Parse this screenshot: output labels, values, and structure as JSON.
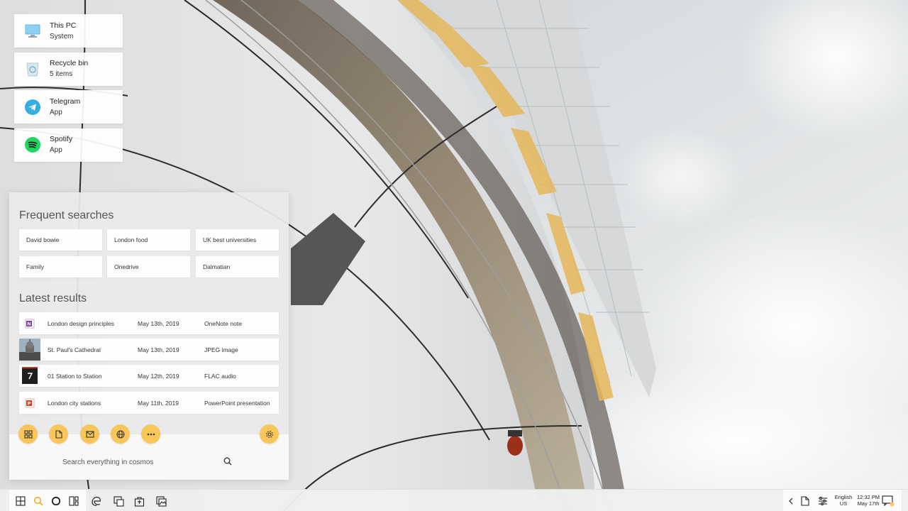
{
  "desktop": {
    "tiles": [
      {
        "name": "This PC",
        "subtitle": "System",
        "icon": "monitor-icon"
      },
      {
        "name": "Recycle bin",
        "subtitle": "5 items",
        "icon": "recycle-bin-icon"
      },
      {
        "name": "Telegram",
        "subtitle": "App",
        "icon": "telegram-icon"
      },
      {
        "name": "Spotify",
        "subtitle": "App",
        "icon": "spotify-icon"
      }
    ]
  },
  "search_panel": {
    "frequent_title": "Frequent searches",
    "frequent": [
      "David bowie",
      "London food",
      "UK best universities",
      "Family",
      "Onedrive",
      "Dalmatian"
    ],
    "latest_title": "Latest results",
    "results": [
      {
        "name": "London design principles",
        "date": "May 13th, 2019",
        "type": "OneNote note",
        "icon": "onenote-icon"
      },
      {
        "name": "St. Paul's Cathedral",
        "date": "May 13th, 2019",
        "type": "JPEG image",
        "icon": "image-thumbnail"
      },
      {
        "name": "01 Station to Station",
        "date": "May 12th, 2019",
        "type": "FLAC audio",
        "icon": "album-art-thumbnail"
      },
      {
        "name": "London city stations",
        "date": "May 11th, 2019",
        "type": "PowerPoint presentation",
        "icon": "powerpoint-icon"
      }
    ],
    "actions": [
      "apps-grid-icon",
      "document-icon",
      "mail-icon",
      "globe-icon",
      "more-icon",
      "settings-icon"
    ],
    "search_placeholder": "Search everything in cosmos"
  },
  "taskbar": {
    "left_icons": [
      "windows-icon",
      "search-icon",
      "cortana-icon",
      "task-view-icon"
    ],
    "pinned_icons": [
      "edge-icon",
      "window-switch-icon",
      "store-icon",
      "photos-icon"
    ],
    "language_line1": "English",
    "language_line2": "US",
    "time": "12:32 PM",
    "date": "May 17th"
  },
  "colors": {
    "accent": "#f9c65a",
    "telegram": "#37aee2",
    "spotify": "#1ed760",
    "onenote": "#7d3da3",
    "powerpoint": "#d24726"
  }
}
